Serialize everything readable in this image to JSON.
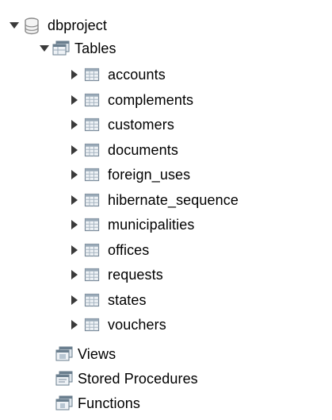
{
  "schema": {
    "name": "dbproject",
    "icon": "database-icon",
    "expanded": true
  },
  "tables_folder": {
    "label": "Tables",
    "icon": "tables-folder-icon",
    "expanded": true,
    "items": [
      {
        "label": "accounts"
      },
      {
        "label": "complements"
      },
      {
        "label": "customers"
      },
      {
        "label": "documents"
      },
      {
        "label": "foreign_uses"
      },
      {
        "label": "hibernate_sequence"
      },
      {
        "label": "municipalities"
      },
      {
        "label": "offices"
      },
      {
        "label": "requests"
      },
      {
        "label": "states"
      },
      {
        "label": "vouchers"
      }
    ]
  },
  "views_folder": {
    "label": "Views",
    "icon": "views-folder-icon"
  },
  "procedures_folder": {
    "label": "Stored Procedures",
    "icon": "procedures-folder-icon"
  },
  "functions_folder": {
    "label": "Functions",
    "icon": "functions-folder-icon"
  },
  "colors": {
    "arrow": "#3a3a3a",
    "db_icon": "#8a8a8a",
    "table_icon_border": "#7a8a9a",
    "table_icon_fill": "#eef2f6",
    "folder_icon": "#6a7e8e"
  }
}
